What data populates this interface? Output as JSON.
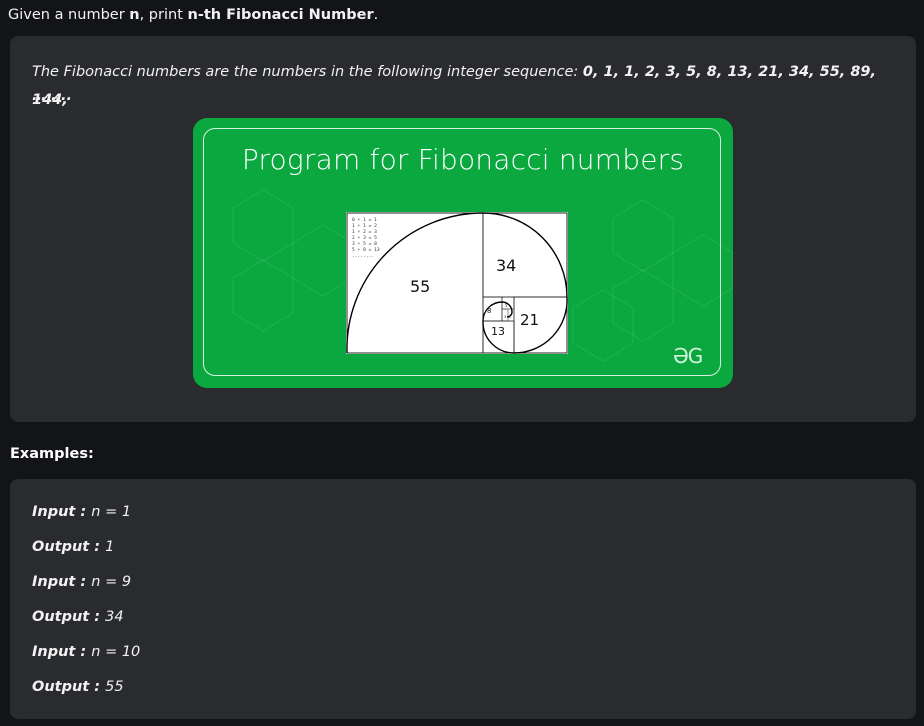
{
  "intro": {
    "prefix": "Given a number ",
    "n": "n",
    "middle": ", print ",
    "target": "n-th Fibonacci Number",
    "suffix": "."
  },
  "description": {
    "text": "The Fibonacci numbers are the numbers in the following integer sequence: ",
    "sequence": "0, 1, 1, 2, 3, 5, 8, 13, 21, 34, 55, 89, 144,",
    "ellipsis": "……..",
    "banner_title": "Program for Fibonacci numbers",
    "logo_text": "ƏG",
    "spiral_labels": {
      "a": "55",
      "b": "34",
      "c": "21",
      "d": "13",
      "e": "8",
      "f": "5",
      "g": "3",
      "h": "2"
    },
    "equations": [
      "0 + 1 = 1",
      "1 + 1 = 2",
      "1 + 2 = 3",
      "2 + 3 = 5",
      "3 + 5 = 8",
      "5 + 8 = 13",
      "........"
    ]
  },
  "examples": {
    "title": "Examples:",
    "items": [
      {
        "key": "Input",
        "sep": " : ",
        "value": "n = 1"
      },
      {
        "key": "Output",
        "sep": " : ",
        "value": "1"
      },
      {
        "key": "Input",
        "sep": " : ",
        "value": "n = 9"
      },
      {
        "key": "Output",
        "sep": " : ",
        "value": "34"
      },
      {
        "key": "Input",
        "sep": " : ",
        "value": "n = 10"
      },
      {
        "key": "Output",
        "sep": " : ",
        "value": "55"
      }
    ]
  },
  "colors": {
    "background": "#131417",
    "card": "#2a2b2f",
    "banner": "#0aa83f"
  }
}
